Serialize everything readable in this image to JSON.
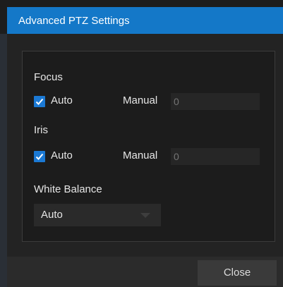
{
  "window": {
    "title": "Advanced PTZ Settings"
  },
  "focus": {
    "section_label": "Focus",
    "auto_label": "Auto",
    "auto_checked": true,
    "manual_label": "Manual",
    "manual_value": "",
    "manual_placeholder": "0"
  },
  "iris": {
    "section_label": "Iris",
    "auto_label": "Auto",
    "auto_checked": true,
    "manual_label": "Manual",
    "manual_value": "",
    "manual_placeholder": "0"
  },
  "white_balance": {
    "section_label": "White Balance",
    "selected": "Auto"
  },
  "footer": {
    "close_label": "Close"
  },
  "colors": {
    "titlebar": "#1478c8",
    "checkbox": "#1b79d4",
    "background": "#1d1d1d"
  },
  "icons": {
    "checkbox": "check-icon",
    "dropdown": "chevron-down-icon"
  }
}
